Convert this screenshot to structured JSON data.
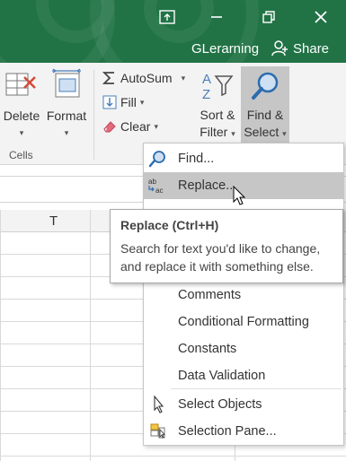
{
  "titlebar": {
    "user": "GLerarning",
    "share_label": "Share"
  },
  "ribbon": {
    "delete_label": "Delete",
    "format_label": "Format",
    "cells_group": "Cells",
    "autosum_label": "AutoSum",
    "fill_label": "Fill",
    "clear_label": "Clear",
    "sort_line1": "Sort &",
    "sort_line2": "Filter",
    "find_line1": "Find &",
    "find_line2": "Select"
  },
  "sheet": {
    "column_label": "T"
  },
  "menu": {
    "find": "Find...",
    "replace": "Replace...",
    "comments": "Comments",
    "conditional": "Conditional Formatting",
    "constants": "Constants",
    "validation": "Data Validation",
    "select_objects": "Select Objects",
    "selection_pane": "Selection Pane..."
  },
  "tooltip": {
    "title": "Replace (Ctrl+H)",
    "body": "Search for text you'd like to change, and replace it with something else."
  },
  "colors": {
    "accent": "#217346",
    "highlight": "#c6c6c6",
    "find_icon_bg": "#cfe0f2"
  }
}
